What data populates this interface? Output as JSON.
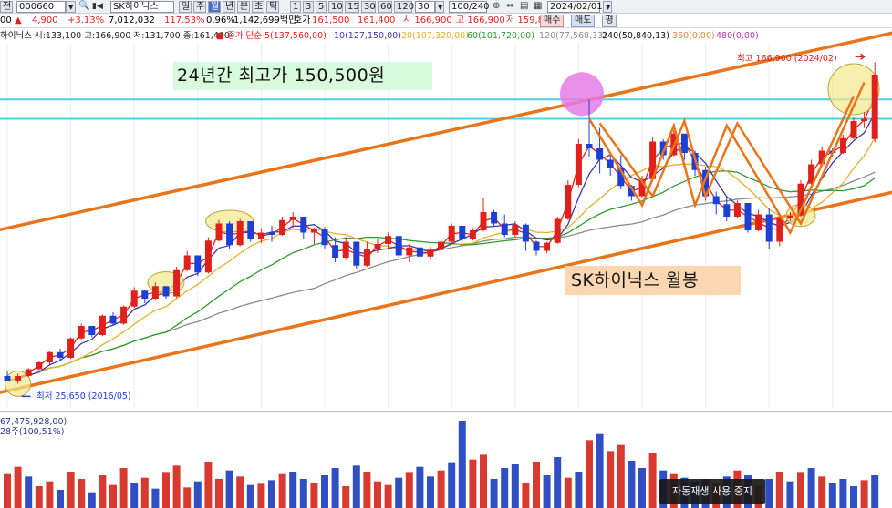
{
  "toolbar": {
    "left_btn": "전",
    "code": "000660",
    "name": "SK하이닉스",
    "period_buttons": [
      "일",
      "주",
      "월",
      "년",
      "분",
      "초",
      "틱"
    ],
    "active_period": 2,
    "intervals": [
      "1",
      "3",
      "5",
      "10",
      "15",
      "30",
      "60",
      "120",
      "30"
    ],
    "count": "100/240",
    "date": "2024/02/01",
    "buy": "매수",
    "sell": "매도",
    "eval": "평"
  },
  "quote": {
    "prefix": "00",
    "arrow": "▲",
    "change": "4,900",
    "change_pct": "+3.13%",
    "volume": "7,012,032",
    "vol_ratio": "117.53%",
    "turnover": "0.96%",
    "trade_amount": "1,142,699백만",
    "ask_label": "호가",
    "ask1": "161,500",
    "ask2": "161,400",
    "open": "시 166,900",
    "high": "고 166,900",
    "low": "저 159,800"
  },
  "ma_legend": {
    "ohlc": "하이닉스 시:133,100 고:166,900 저:131,700 종:161,400",
    "ma_title": "종가 단순",
    "ma5": "5(137,560,00)",
    "ma10": "10(127,150,00)",
    "ma20": "20(107,320,00)",
    "ma60": "60(101,720,00)",
    "ma120": "120(77,568,33)",
    "ma240": "240(50,840,13)",
    "ma360": "360(0,00)",
    "ma480": "480(0,00)"
  },
  "colors": {
    "up": "#e0211b",
    "down": "#1c3fd6",
    "ma5": "#e0211b",
    "ma10": "#3a3aa8",
    "ma20": "#e0b12a",
    "ma60": "#2f9a2f",
    "ma120": "#8c8c8c",
    "channel": "#e8741c",
    "hline": "#4fd0ea",
    "highlight": "#f2e88a",
    "peak_marker": "#e47de6"
  },
  "annotations": {
    "box_title": "24년간 최고가 150,500원",
    "box_name": "SK하이닉스 월봉",
    "high_label": "최고 166,900 (2024/02)",
    "low_label": "최저 25,650 (2016/05)"
  },
  "volume_panel": {
    "value_label": "67,475,928,00)",
    "ma_label": "28주(100,51%)"
  },
  "tooltip": "자동재생 사용 중지",
  "chart_data": {
    "type": "candlestick",
    "title": "SK하이닉스 월봉",
    "ylim": [
      15000,
      175000
    ],
    "hlines": [
      150500,
      142000
    ],
    "candles": [
      [
        29000,
        31500,
        27500,
        27000,
        0
      ],
      [
        27000,
        30000,
        25650,
        29000,
        1
      ],
      [
        29000,
        32500,
        28500,
        32000,
        1
      ],
      [
        32000,
        35500,
        31500,
        35000,
        1
      ],
      [
        35000,
        40000,
        34000,
        39500,
        1
      ],
      [
        39500,
        41000,
        36000,
        37000,
        0
      ],
      [
        37000,
        46000,
        36500,
        45500,
        1
      ],
      [
        45500,
        52000,
        45000,
        51000,
        1
      ],
      [
        51000,
        50500,
        46000,
        47000,
        0
      ],
      [
        47000,
        56000,
        46500,
        55500,
        1
      ],
      [
        55500,
        57000,
        51000,
        52000,
        0
      ],
      [
        52000,
        60000,
        51500,
        59500,
        1
      ],
      [
        59500,
        68000,
        59000,
        66500,
        1
      ],
      [
        66500,
        67000,
        61000,
        63000,
        0
      ],
      [
        63000,
        70000,
        62500,
        68500,
        1
      ],
      [
        68500,
        67500,
        63000,
        64000,
        0
      ],
      [
        64000,
        77000,
        63500,
        75500,
        1
      ],
      [
        75500,
        84000,
        75000,
        82000,
        1
      ],
      [
        82000,
        81000,
        73000,
        74500,
        0
      ],
      [
        74500,
        90000,
        74000,
        88500,
        1
      ],
      [
        88500,
        97500,
        88000,
        96000,
        1
      ],
      [
        96000,
        97000,
        85000,
        86500,
        0
      ],
      [
        86500,
        98000,
        86000,
        97000,
        1
      ],
      [
        97000,
        96000,
        88000,
        89000,
        0
      ],
      [
        89000,
        94000,
        87500,
        92000,
        1
      ],
      [
        92000,
        95000,
        88000,
        91000,
        0
      ],
      [
        91000,
        99000,
        90500,
        97500,
        1
      ],
      [
        97500,
        101000,
        94000,
        99000,
        1
      ],
      [
        99000,
        98500,
        89000,
        92000,
        0
      ],
      [
        92000,
        94000,
        87000,
        93500,
        1
      ],
      [
        93500,
        94500,
        85000,
        86500,
        0
      ],
      [
        86500,
        90000,
        79000,
        81000,
        0
      ],
      [
        81000,
        90000,
        80000,
        88000,
        1
      ],
      [
        88000,
        87500,
        76000,
        77500,
        0
      ],
      [
        77500,
        88000,
        77000,
        85000,
        1
      ],
      [
        85000,
        89000,
        83000,
        87000,
        1
      ],
      [
        87000,
        92000,
        84500,
        90500,
        1
      ],
      [
        90500,
        89500,
        81000,
        82000,
        0
      ],
      [
        82000,
        87000,
        79000,
        85500,
        1
      ],
      [
        85500,
        86500,
        80500,
        81500,
        0
      ],
      [
        81500,
        86000,
        80000,
        84500,
        1
      ],
      [
        84500,
        89000,
        82500,
        88000,
        1
      ],
      [
        88000,
        96000,
        87500,
        95000,
        1
      ],
      [
        95000,
        94500,
        88000,
        89000,
        0
      ],
      [
        89000,
        94000,
        88500,
        93000,
        1
      ],
      [
        93000,
        107000,
        92500,
        101000,
        1
      ],
      [
        101000,
        102000,
        95000,
        96000,
        0
      ],
      [
        96000,
        100000,
        90000,
        91000,
        0
      ],
      [
        91000,
        97000,
        90000,
        95500,
        1
      ],
      [
        95500,
        96000,
        84000,
        88000,
        0
      ],
      [
        88000,
        88500,
        82000,
        84000,
        0
      ],
      [
        84000,
        88000,
        83000,
        87500,
        1
      ],
      [
        87500,
        99000,
        87000,
        98000,
        1
      ],
      [
        98000,
        115000,
        97500,
        113000,
        1
      ],
      [
        113000,
        133000,
        112000,
        131000,
        1
      ],
      [
        131000,
        150500,
        125000,
        129000,
        0
      ],
      [
        129000,
        138000,
        118000,
        124000,
        0
      ],
      [
        124000,
        127000,
        117000,
        120500,
        0
      ],
      [
        120500,
        126000,
        111000,
        112500,
        0
      ],
      [
        112500,
        113000,
        106000,
        108000,
        0
      ],
      [
        108000,
        117000,
        107000,
        115500,
        1
      ],
      [
        115500,
        134000,
        115000,
        132000,
        1
      ],
      [
        132000,
        133000,
        124000,
        126000,
        0
      ],
      [
        126000,
        137000,
        125500,
        135500,
        1
      ],
      [
        135500,
        134000,
        124000,
        127000,
        0
      ],
      [
        127000,
        128000,
        117000,
        119500,
        0
      ],
      [
        119500,
        121000,
        106000,
        108000,
        0
      ],
      [
        108000,
        110000,
        100000,
        104500,
        0
      ],
      [
        104500,
        108000,
        97000,
        99000,
        0
      ],
      [
        99000,
        106000,
        98500,
        105000,
        1
      ],
      [
        105000,
        104500,
        92000,
        93000,
        0
      ],
      [
        93000,
        102000,
        92500,
        100000,
        1
      ],
      [
        100000,
        103000,
        85000,
        88000,
        0
      ],
      [
        88000,
        100000,
        86000,
        98500,
        1
      ],
      [
        98500,
        101000,
        97000,
        99500,
        1
      ],
      [
        99500,
        115000,
        99000,
        113500,
        1
      ],
      [
        113500,
        124000,
        113000,
        122000,
        1
      ],
      [
        122000,
        130000,
        121000,
        128000,
        1
      ],
      [
        128000,
        129000,
        125000,
        127000,
        0
      ],
      [
        127000,
        135000,
        126500,
        133500,
        1
      ],
      [
        133500,
        143000,
        133000,
        141000,
        1
      ],
      [
        141000,
        145000,
        138000,
        142000,
        1
      ],
      [
        133100,
        166900,
        131700,
        161400,
        1
      ]
    ],
    "volumes": [
      [
        28,
        1
      ],
      [
        34,
        1
      ],
      [
        26,
        0
      ],
      [
        18,
        1
      ],
      [
        22,
        1
      ],
      [
        15,
        0
      ],
      [
        30,
        1
      ],
      [
        24,
        1
      ],
      [
        13,
        0
      ],
      [
        27,
        1
      ],
      [
        19,
        1
      ],
      [
        33,
        1
      ],
      [
        21,
        0
      ],
      [
        25,
        1
      ],
      [
        16,
        0
      ],
      [
        29,
        1
      ],
      [
        35,
        1
      ],
      [
        17,
        1
      ],
      [
        22,
        0
      ],
      [
        38,
        1
      ],
      [
        24,
        1
      ],
      [
        31,
        0
      ],
      [
        26,
        1
      ],
      [
        19,
        0
      ],
      [
        20,
        1
      ],
      [
        23,
        0
      ],
      [
        28,
        1
      ],
      [
        30,
        0
      ],
      [
        24,
        0
      ],
      [
        21,
        1
      ],
      [
        27,
        0
      ],
      [
        33,
        0
      ],
      [
        18,
        1
      ],
      [
        35,
        0
      ],
      [
        30,
        1
      ],
      [
        22,
        1
      ],
      [
        19,
        1
      ],
      [
        25,
        0
      ],
      [
        29,
        1
      ],
      [
        34,
        0
      ],
      [
        26,
        0
      ],
      [
        31,
        1
      ],
      [
        37,
        0
      ],
      [
        72,
        0
      ],
      [
        40,
        1
      ],
      [
        44,
        1
      ],
      [
        24,
        0
      ],
      [
        33,
        0
      ],
      [
        36,
        0
      ],
      [
        21,
        1
      ],
      [
        38,
        1
      ],
      [
        27,
        0
      ],
      [
        42,
        0
      ],
      [
        25,
        1
      ],
      [
        30,
        0
      ],
      [
        56,
        1
      ],
      [
        61,
        0
      ],
      [
        47,
        1
      ],
      [
        52,
        1
      ],
      [
        39,
        0
      ],
      [
        33,
        0
      ],
      [
        45,
        1
      ],
      [
        31,
        0
      ],
      [
        28,
        1
      ],
      [
        25,
        0
      ],
      [
        22,
        0
      ],
      [
        24,
        0
      ],
      [
        20,
        1
      ],
      [
        26,
        0
      ],
      [
        31,
        1
      ],
      [
        27,
        0
      ],
      [
        18,
        1
      ],
      [
        24,
        0
      ],
      [
        30,
        1
      ],
      [
        22,
        0
      ],
      [
        29,
        1
      ],
      [
        33,
        0
      ],
      [
        26,
        1
      ],
      [
        21,
        0
      ],
      [
        24,
        0
      ],
      [
        18,
        0
      ],
      [
        23,
        1
      ],
      [
        27,
        0
      ]
    ]
  }
}
